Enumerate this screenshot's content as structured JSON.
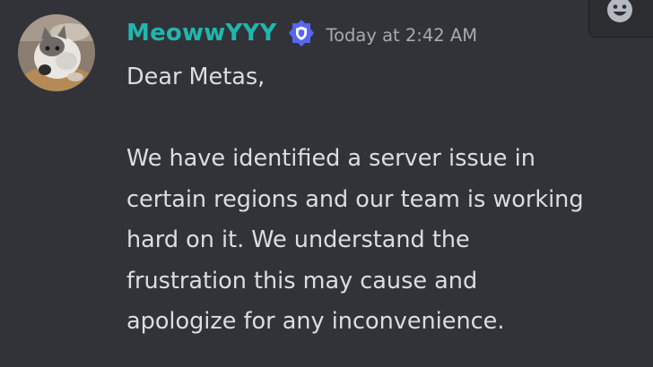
{
  "message": {
    "author": "MeowwYYY",
    "badge_icon": "shield-badge-icon",
    "timestamp": "Today at 2:42 AM",
    "greeting": "Dear Metas,",
    "paragraph_lines": [
      "We have identified a server issue in",
      "certain regions and our team is working",
      "hard on it. We understand the",
      "frustration this may cause and",
      "apologize for any inconvenience."
    ]
  },
  "toolbar": {
    "add_reaction_icon": "emoji-smile-icon"
  },
  "colors": {
    "background": "#313338",
    "username": "#1fb7ad",
    "badge": "#5865f2",
    "timestamp": "#a7aab3",
    "text": "#dbdee1"
  }
}
